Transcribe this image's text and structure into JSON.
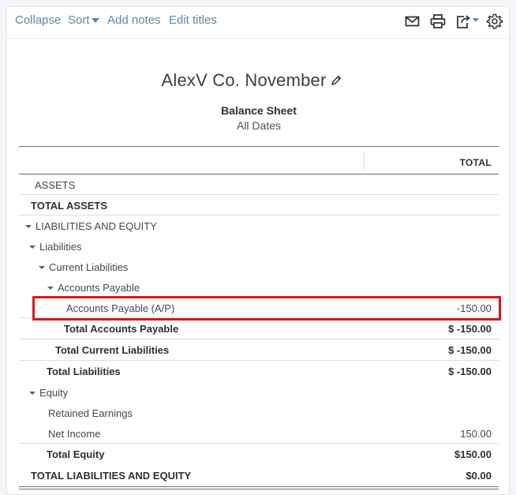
{
  "toolbar": {
    "collapse": "Collapse",
    "sort": "Sort",
    "add_notes": "Add notes",
    "edit_titles": "Edit titles",
    "icons": [
      "email-icon",
      "print-icon",
      "export-icon",
      "settings-icon"
    ]
  },
  "report": {
    "company": "AlexV Co. November",
    "title": "Balance Sheet",
    "dates": "All Dates",
    "column_total": "TOTAL"
  },
  "rows": [
    {
      "label": "ASSETS",
      "amount": ""
    },
    {
      "label": "TOTAL ASSETS",
      "amount": ""
    },
    {
      "label": "LIABILITIES AND EQUITY",
      "amount": ""
    },
    {
      "label": "Liabilities",
      "amount": ""
    },
    {
      "label": "Current Liabilities",
      "amount": ""
    },
    {
      "label": "Accounts Payable",
      "amount": ""
    },
    {
      "label": "Accounts Payable (A/P)",
      "amount": "-150.00"
    },
    {
      "label": "Total Accounts Payable",
      "amount": "$ -150.00"
    },
    {
      "label": "Total Current Liabilities",
      "amount": "$ -150.00"
    },
    {
      "label": "Total Liabilities",
      "amount": "$ -150.00"
    },
    {
      "label": "Equity",
      "amount": ""
    },
    {
      "label": "Retained Earnings",
      "amount": ""
    },
    {
      "label": "Net Income",
      "amount": "150.00"
    },
    {
      "label": "Total Equity",
      "amount": "$150.00"
    },
    {
      "label": "TOTAL LIABILITIES AND EQUITY",
      "amount": "$0.00"
    }
  ],
  "colors": {
    "link": "#5f87a8",
    "highlight": "#e0141b"
  }
}
